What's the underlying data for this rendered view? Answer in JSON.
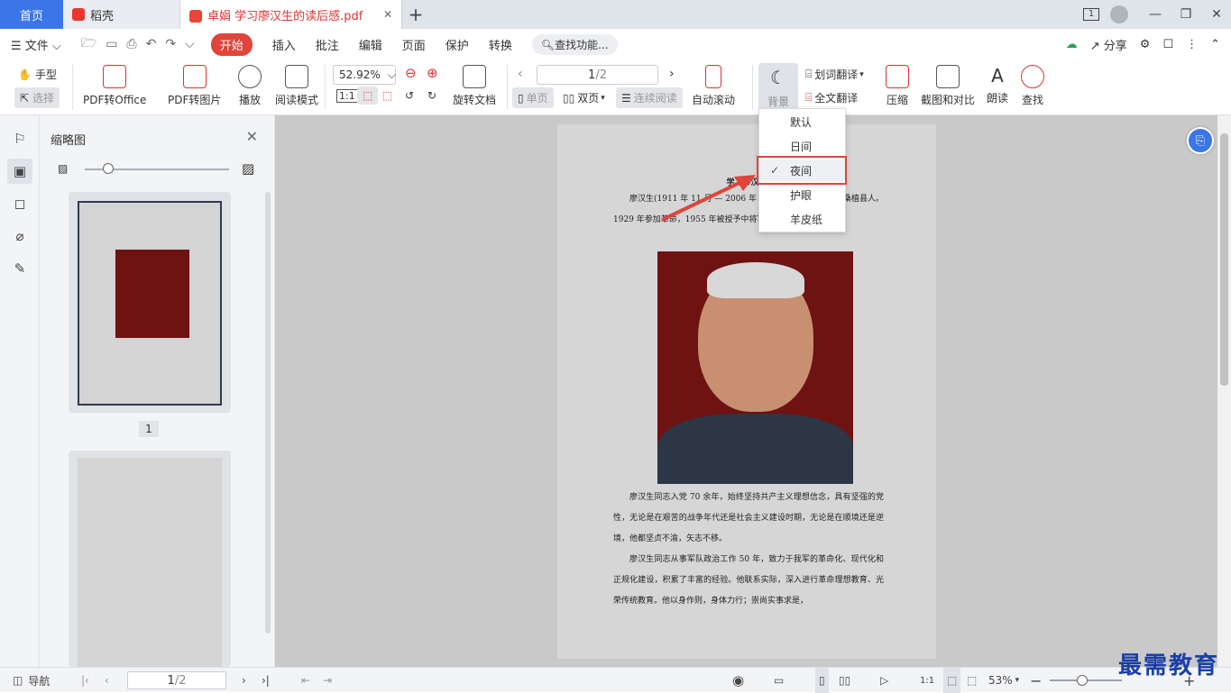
{
  "tabs": {
    "home": "首页",
    "daoke": "稻壳",
    "doc": "卓娟 学习廖汉生的读后感.pdf",
    "close": "✕",
    "plus": "+"
  },
  "window": {
    "badge": "1",
    "min": "—",
    "restore": "❐",
    "close": "✕"
  },
  "menu": {
    "file": "文件",
    "items": [
      "开始",
      "插入",
      "批注",
      "编辑",
      "页面",
      "保护",
      "转换"
    ],
    "search": "查找功能...",
    "share": "分享"
  },
  "toolbar": {
    "hand": "手型",
    "select": "选择",
    "pdf_office": "PDF转Office",
    "pdf_image": "PDF转图片",
    "play": "播放",
    "read_mode": "阅读模式",
    "zoom": "52.92%",
    "rotate_doc": "旋转文档",
    "page_value": "1",
    "page_total": "/2",
    "single": "单页",
    "double": "双页",
    "continuous": "连续阅读",
    "auto_scroll": "自动滚动",
    "background": "背景",
    "word_translate": "划词翻译",
    "full_translate": "全文翻译",
    "compress": "压缩",
    "screenshot_compare": "截图和对比",
    "read_aloud": "朗读",
    "find": "查找"
  },
  "background_menu": {
    "items": [
      "默认",
      "日间",
      "夜间",
      "护眼",
      "羊皮纸"
    ],
    "selected": "夜间"
  },
  "thumbnail": {
    "title": "缩略图",
    "page1": "1"
  },
  "document": {
    "title": "学习廖汉生",
    "p1": "廖汉生(1911 年 11 月 — 2006 年 8 月)，土家族，湖南省桑植县人。1929 年参加革命，1955 年被授予中将军衔。",
    "p2": "廖汉生同志入党 70 余年，始终坚持共产主义理想信念，具有坚强的党性，无论是在艰苦的战争年代还是社会主义建设时期，无论是在顺境还是逆境，他都坚贞不渝，矢志不移。",
    "p3": "廖汉生同志从事军队政治工作 50 年，致力于我军的革命化、现代化和正规化建设，积累了丰富的经验。他联系实际，深入进行革命理想教育、光荣传统教育。他以身作则，身体力行；崇尚实事求是，"
  },
  "status": {
    "nav": "导航",
    "page_value": "1",
    "page_total": "/2",
    "zoom": "53%"
  },
  "watermark": "最需教育"
}
